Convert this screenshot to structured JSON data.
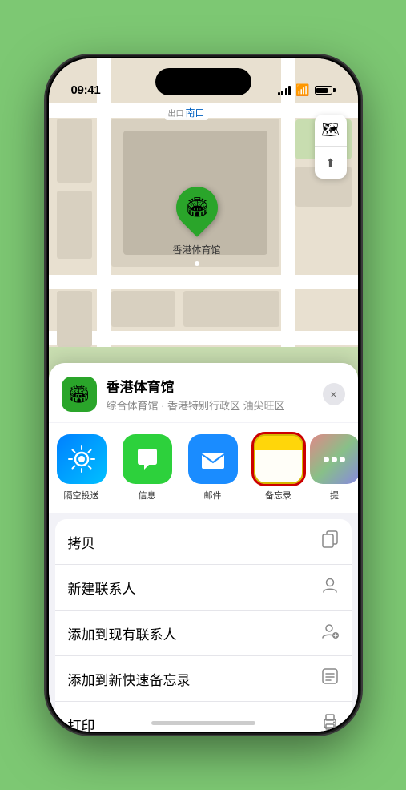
{
  "status_bar": {
    "time": "09:41",
    "location_arrow": "▶"
  },
  "map": {
    "label_text": "南口",
    "label_prefix": "出口",
    "pin_label": "香港体育馆",
    "controls": {
      "map_btn": "🗺",
      "location_btn": "⬆"
    }
  },
  "location_header": {
    "name": "香港体育馆",
    "subtitle": "综合体育馆 · 香港特别行政区 油尖旺区",
    "close": "×"
  },
  "share_items": [
    {
      "id": "airdrop",
      "label": "隔空投送",
      "icon": "📡"
    },
    {
      "id": "messages",
      "label": "信息",
      "icon": "💬"
    },
    {
      "id": "mail",
      "label": "邮件",
      "icon": "✉"
    },
    {
      "id": "notes",
      "label": "备忘录",
      "icon": "📝"
    },
    {
      "id": "more",
      "label": "提",
      "icon": "•••"
    }
  ],
  "actions": [
    {
      "label": "拷贝",
      "icon": "⎘"
    },
    {
      "label": "新建联系人",
      "icon": "👤"
    },
    {
      "label": "添加到现有联系人",
      "icon": "👤+"
    },
    {
      "label": "添加到新快速备忘录",
      "icon": "📋"
    },
    {
      "label": "打印",
      "icon": "🖨"
    }
  ]
}
